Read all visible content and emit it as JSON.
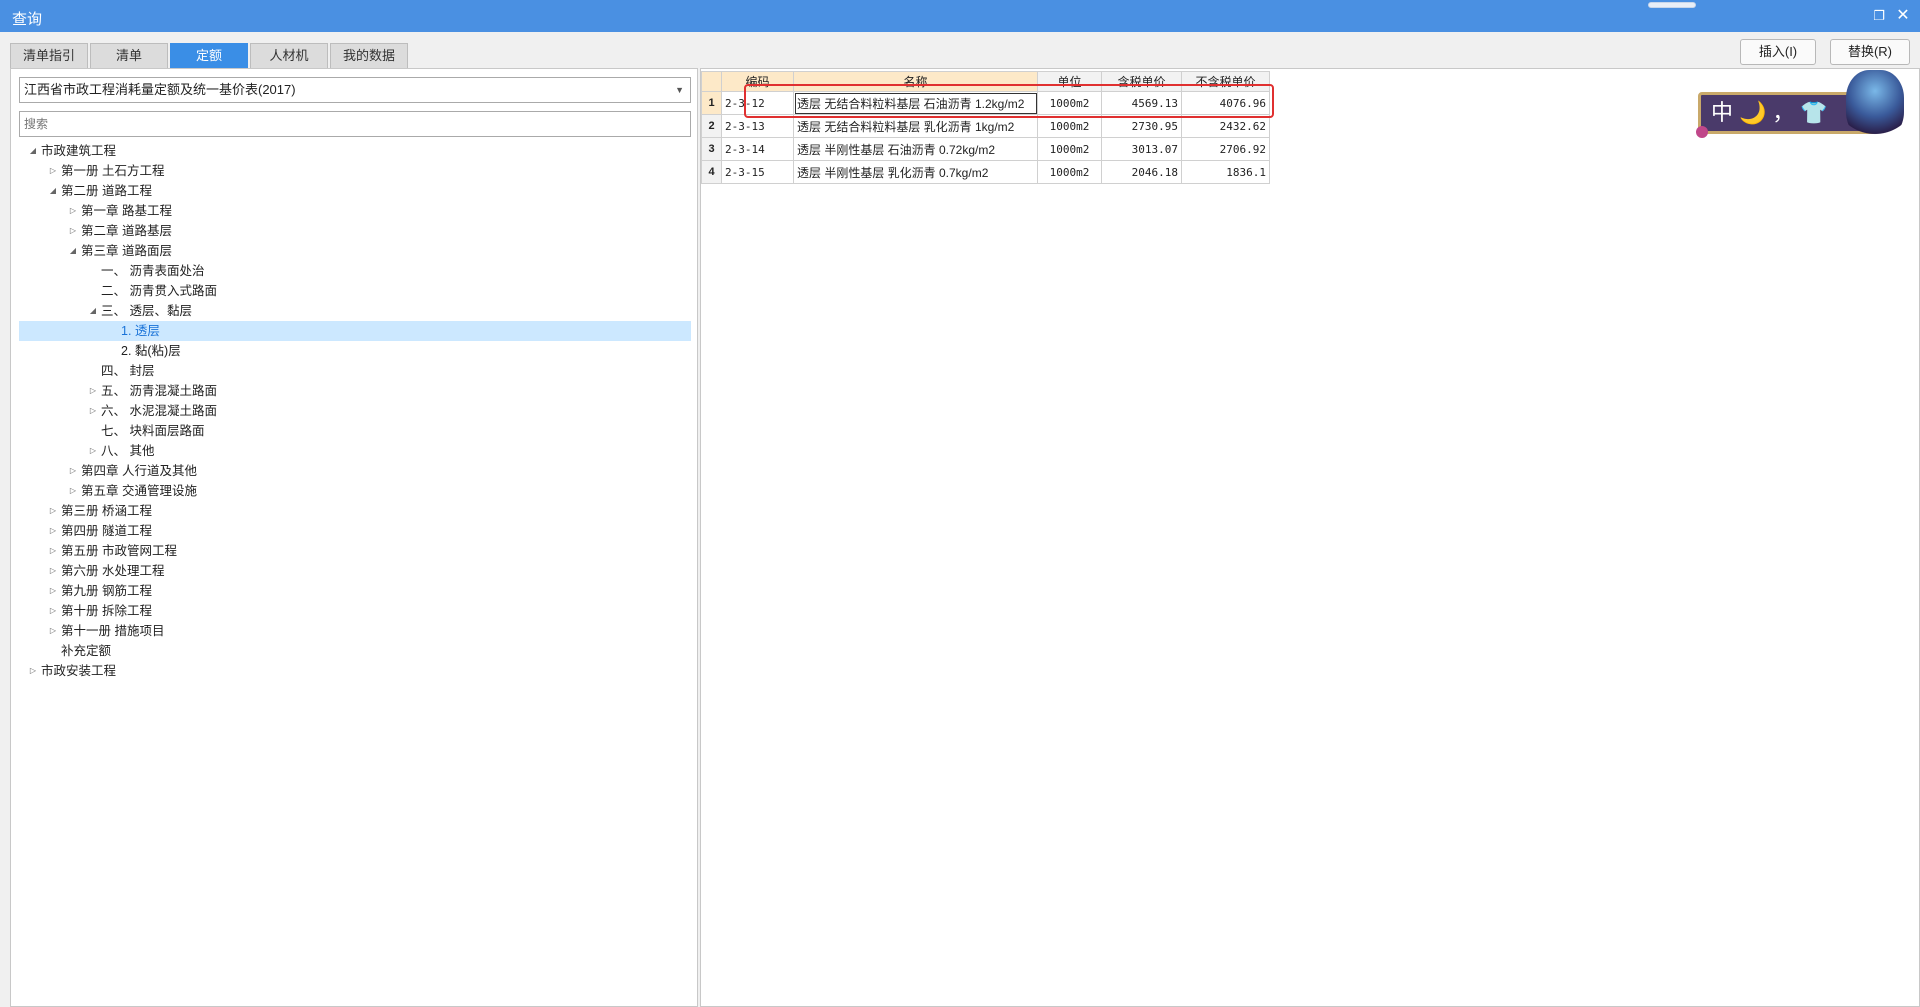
{
  "window": {
    "title": "查询",
    "restore_icon": "restore-icon",
    "close_icon": "close-icon"
  },
  "tabs": [
    {
      "label": "清单指引",
      "active": false
    },
    {
      "label": "清单",
      "active": false
    },
    {
      "label": "定额",
      "active": true
    },
    {
      "label": "人材机",
      "active": false
    },
    {
      "label": "我的数据",
      "active": false
    }
  ],
  "actions": {
    "insert_label": "插入(I)",
    "replace_label": "替换(R)"
  },
  "left": {
    "library_select": "江西省市政工程消耗量定额及统一基价表(2017)",
    "search_placeholder": "搜索",
    "tree": [
      {
        "label": "市政建筑工程",
        "level": 0,
        "toggle": "expanded"
      },
      {
        "label": "第一册 土石方工程",
        "level": 1,
        "toggle": "collapsed"
      },
      {
        "label": "第二册 道路工程",
        "level": 1,
        "toggle": "expanded"
      },
      {
        "label": "第一章 路基工程",
        "level": 2,
        "toggle": "collapsed"
      },
      {
        "label": "第二章 道路基层",
        "level": 2,
        "toggle": "collapsed"
      },
      {
        "label": "第三章 道路面层",
        "level": 2,
        "toggle": "expanded"
      },
      {
        "label": "一、 沥青表面处治",
        "level": 3,
        "toggle": "none"
      },
      {
        "label": "二、 沥青贯入式路面",
        "level": 3,
        "toggle": "none"
      },
      {
        "label": "三、 透层、黏层",
        "level": 3,
        "toggle": "expanded"
      },
      {
        "label": "1. 透层",
        "level": 4,
        "toggle": "none",
        "selected": true
      },
      {
        "label": "2. 黏(粘)层",
        "level": 4,
        "toggle": "none"
      },
      {
        "label": "四、 封层",
        "level": 3,
        "toggle": "none"
      },
      {
        "label": "五、 沥青混凝土路面",
        "level": 3,
        "toggle": "collapsed"
      },
      {
        "label": "六、 水泥混凝土路面",
        "level": 3,
        "toggle": "collapsed"
      },
      {
        "label": "七、 块料面层路面",
        "level": 3,
        "toggle": "none"
      },
      {
        "label": "八、 其他",
        "level": 3,
        "toggle": "collapsed"
      },
      {
        "label": "第四章 人行道及其他",
        "level": 2,
        "toggle": "collapsed"
      },
      {
        "label": "第五章 交通管理设施",
        "level": 2,
        "toggle": "collapsed"
      },
      {
        "label": "第三册 桥涵工程",
        "level": 1,
        "toggle": "collapsed"
      },
      {
        "label": "第四册 隧道工程",
        "level": 1,
        "toggle": "collapsed"
      },
      {
        "label": "第五册 市政管网工程",
        "level": 1,
        "toggle": "collapsed"
      },
      {
        "label": "第六册 水处理工程",
        "level": 1,
        "toggle": "collapsed"
      },
      {
        "label": "第九册 钢筋工程",
        "level": 1,
        "toggle": "collapsed"
      },
      {
        "label": "第十册 拆除工程",
        "level": 1,
        "toggle": "collapsed"
      },
      {
        "label": "第十一册 措施项目",
        "level": 1,
        "toggle": "collapsed"
      },
      {
        "label": "补充定额",
        "level": 1,
        "toggle": "none"
      },
      {
        "label": "市政安装工程",
        "level": 0,
        "toggle": "collapsed"
      }
    ]
  },
  "grid": {
    "headers": [
      "编码",
      "名称",
      "单位",
      "含税单价",
      "不含税单价"
    ],
    "rows": [
      {
        "no": "1",
        "code": "2-3-12",
        "name": "透层 无结合料粒料基层 石油沥青 1.2kg/m2",
        "unit": "1000m2",
        "tax_price": "4569.13",
        "notax_price": "4076.96"
      },
      {
        "no": "2",
        "code": "2-3-13",
        "name": "透层 无结合料粒料基层 乳化沥青 1kg/m2",
        "unit": "1000m2",
        "tax_price": "2730.95",
        "notax_price": "2432.62"
      },
      {
        "no": "3",
        "code": "2-3-14",
        "name": "透层 半刚性基层 石油沥青 0.72kg/m2",
        "unit": "1000m2",
        "tax_price": "3013.07",
        "notax_price": "2706.92"
      },
      {
        "no": "4",
        "code": "2-3-15",
        "name": "透层 半刚性基层 乳化沥青 0.7kg/m2",
        "unit": "1000m2",
        "tax_price": "2046.18",
        "notax_price": "1836.1"
      }
    ]
  },
  "badge": {
    "text": "中🌙，👕"
  }
}
